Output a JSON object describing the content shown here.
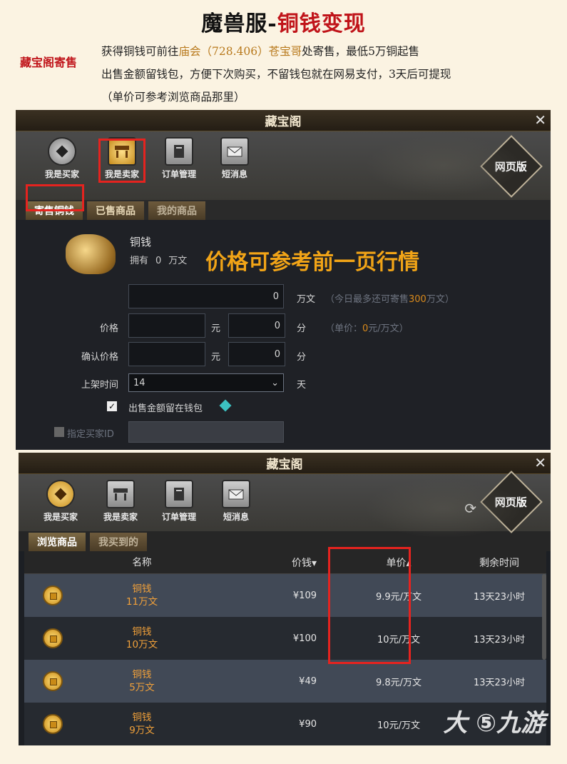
{
  "page": {
    "title_part1": "魔兽服-",
    "title_part2": "铜钱变现",
    "note_label": "藏宝阁寄售",
    "note1_pre": "获得铜钱可前往",
    "note1_hl": "庙会（728.406）苍宝哥",
    "note1_post": "处寄售，最低5万铜起售",
    "note2": "出售金额留钱包，方便下次购买，不留钱包就在网易支付，3天后可提现",
    "note3": "（单价可参考浏览商品那里）"
  },
  "sell_panel": {
    "title": "藏宝阁",
    "close": "✕",
    "nav": [
      "我是买家",
      "我是卖家",
      "订单管理",
      "短消息"
    ],
    "web_button": "网页版",
    "tabs": [
      "寄售铜钱",
      "已售商品",
      "我的商品"
    ],
    "item_name": "铜钱",
    "own_label": "拥有",
    "own_value": "0",
    "own_unit": "万文",
    "price_hint": "价格可参考前一页行情",
    "amount_value": "0",
    "amount_unit": "万文",
    "amount_note_pre": "（今日最多还可寄售",
    "amount_note_num": "300",
    "amount_note_post": "万文）",
    "price_label": "价格",
    "yuan": "元",
    "fen": "分",
    "fen_value": "0",
    "unit_price_pre": "（单价：",
    "unit_price_num": "0",
    "unit_price_post": "元/万文）",
    "confirm_label": "确认价格",
    "confirm_fen_value": "0",
    "listing_label": "上架时间",
    "listing_value": "14",
    "listing_unit": "天",
    "keep_wallet": "出售金额留在钱包",
    "buyer_id": "指定买家ID"
  },
  "buy_panel": {
    "title": "藏宝阁",
    "close": "✕",
    "nav": [
      "我是买家",
      "我是卖家",
      "订单管理",
      "短消息"
    ],
    "web_button": "网页版",
    "tabs": [
      "浏览商品",
      "我买到的"
    ],
    "columns": [
      "名称",
      "价钱▾",
      "单价▴",
      "剩余时间"
    ],
    "rows": [
      {
        "name": "铜钱",
        "qty": "11万文",
        "price": "¥109",
        "unit": "9.9元/万文",
        "time": "13天23小时"
      },
      {
        "name": "铜钱",
        "qty": "10万文",
        "price": "¥100",
        "unit": "10元/万文",
        "time": "13天23小时"
      },
      {
        "name": "铜钱",
        "qty": "5万文",
        "price": "¥49",
        "unit": "9.8元/万文",
        "time": "13天23小时"
      },
      {
        "name": "铜钱",
        "qty": "9万文",
        "price": "¥90",
        "unit": "10元/万文",
        "time": ""
      }
    ],
    "watermark": "大 ⑤九游"
  }
}
